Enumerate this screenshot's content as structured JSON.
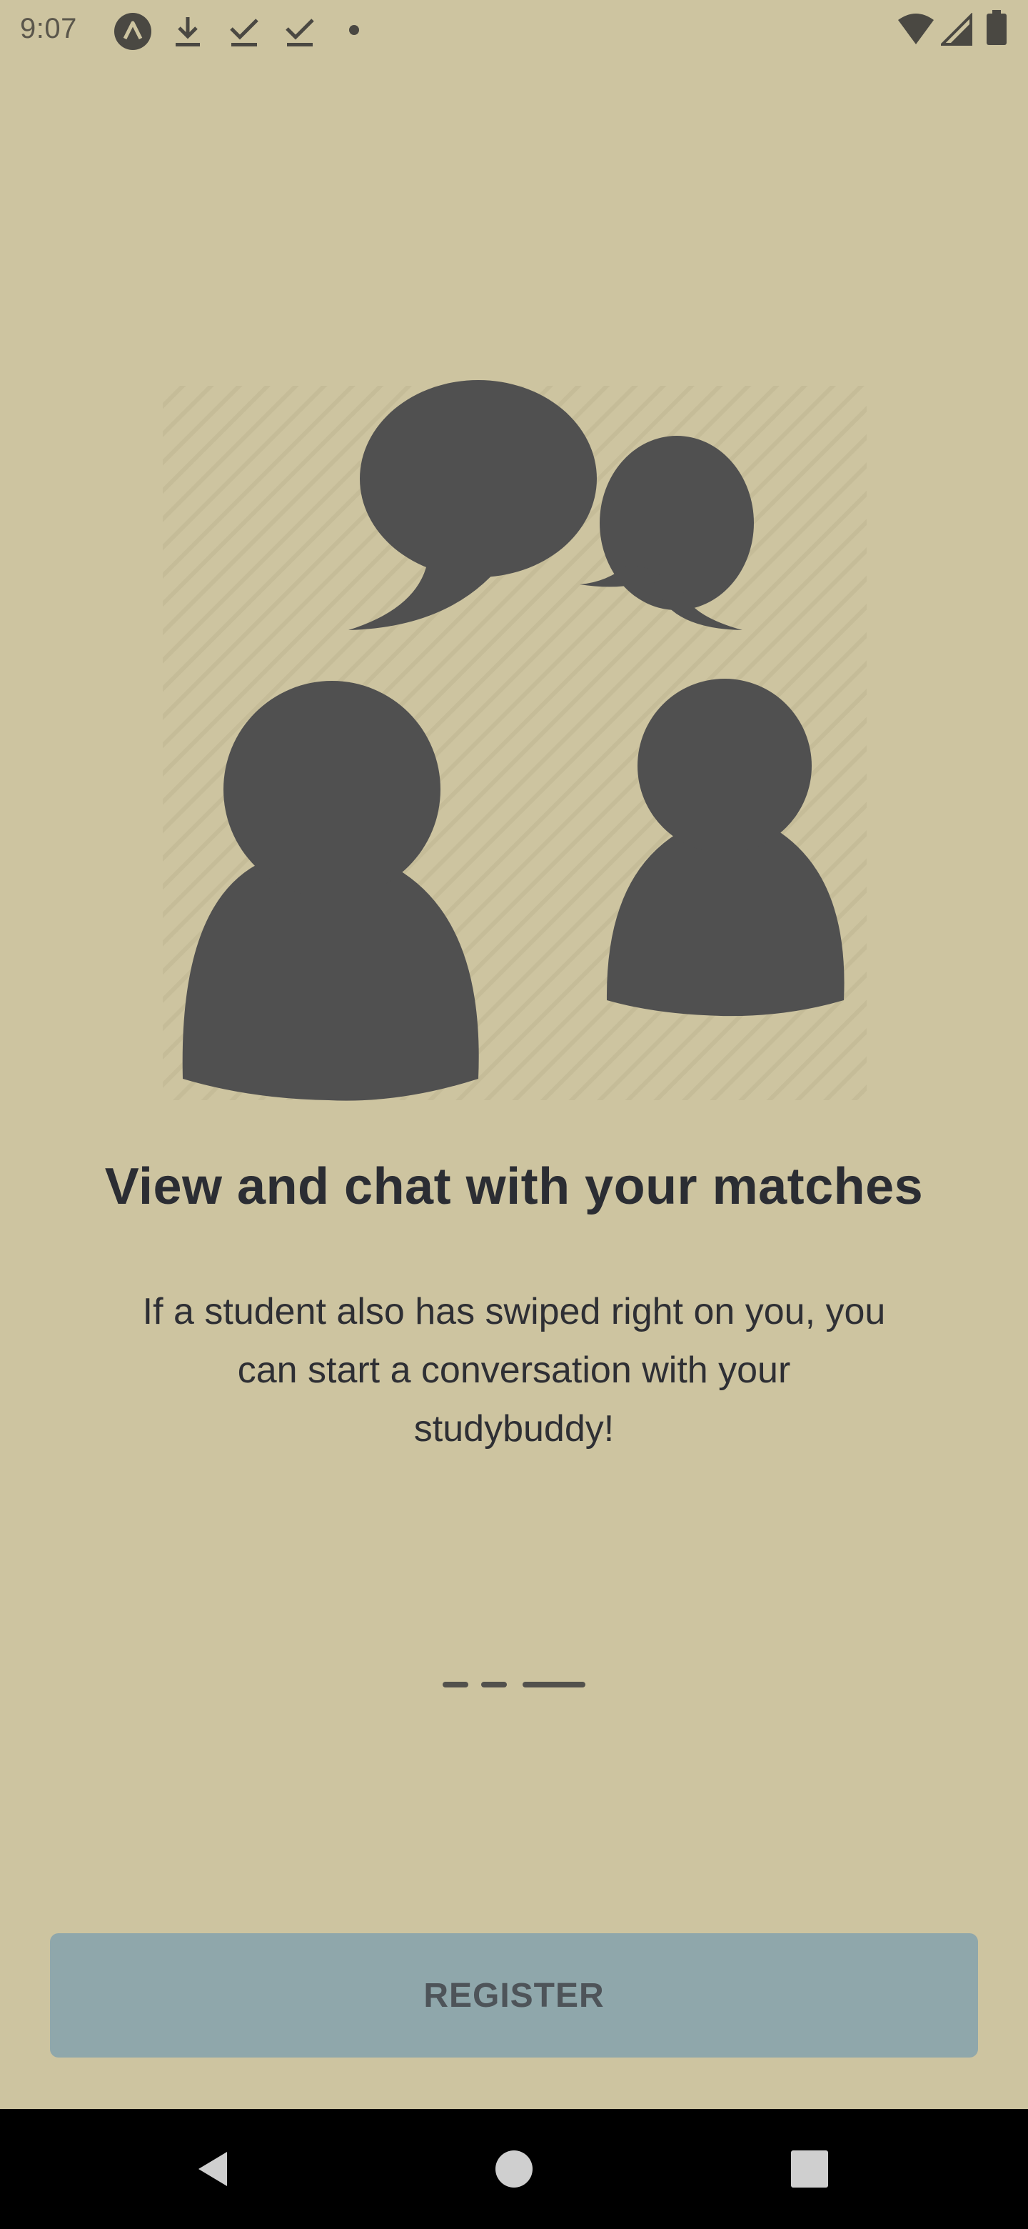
{
  "status_bar": {
    "time": "9:07",
    "left_icons": [
      "app-notification-icon",
      "download-icon",
      "check-download-icon",
      "check-download-icon",
      "dot-icon"
    ],
    "right_icons": [
      "wifi-icon",
      "cell-signal-icon",
      "battery-icon"
    ]
  },
  "onboarding": {
    "illustration": "chat-people-illustration",
    "title": "View and chat with your matches",
    "description": "If a student also has swiped right on you, you can start a conversation with your studybuddy!",
    "page_indicator": {
      "pages": 3,
      "active": 3
    }
  },
  "register_button": {
    "label": "REGISTER"
  },
  "nav_bar": {
    "icons": [
      "back-icon",
      "home-icon",
      "recents-icon"
    ]
  },
  "colors": {
    "background": "#cdc4a0",
    "illustration": "#505050",
    "button": "#8fa7ab",
    "text": "#2b2d33"
  }
}
